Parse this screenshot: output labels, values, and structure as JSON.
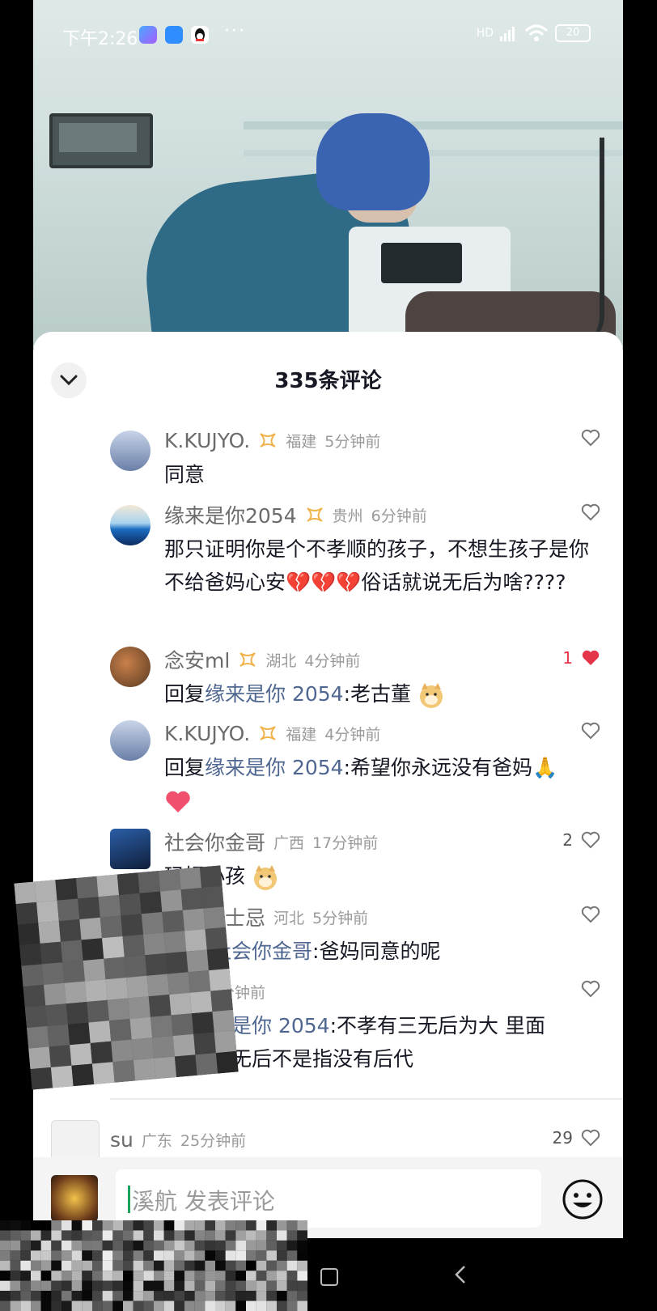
{
  "status_bar": {
    "time": "下午2:26",
    "dots": "···",
    "network": "HD",
    "battery": "20"
  },
  "sheet": {
    "title": "335条评论"
  },
  "comments": [
    {
      "user": "K.KUJYO.",
      "location": "福建",
      "time": "5分钟前",
      "text": "同意",
      "likes": ""
    },
    {
      "user": "缘来是你2054",
      "location": "贵州",
      "time": "6分钟前",
      "text": "那只证明你是个不孝顺的孩子，不想生孩子是你不给爸妈心安💔💔💔俗话就说无后为啥????",
      "likes": ""
    },
    {
      "user": "念安ml",
      "location": "湖北",
      "time": "4分钟前",
      "reply_prefix": "回复",
      "reply_to": "缘来是你 2054",
      "text": ":老古董",
      "likes": "1"
    },
    {
      "user": "K.KUJYO.",
      "location": "福建",
      "time": "4分钟前",
      "reply_prefix": "回复",
      "reply_to": "缘来是你 2054",
      "text": ":希望你永远没有爸妈🙏",
      "likes": ""
    },
    {
      "user": "社会你金哥",
      "location": "广西",
      "time": "17分钟前",
      "text": "玛娌小孩",
      "likes": "2"
    },
    {
      "user": "威士忌",
      "location": "河北",
      "time": "5分钟前",
      "reply_to": "社会你金哥",
      "text": ":爸妈同意的呢",
      "likes": ""
    },
    {
      "user": "",
      "location": "",
      "time": "分钟前",
      "reply_to": "来是你 2054",
      "text": ":不孝有三无后为大 里面",
      "text2": "的无后不是指没有后代",
      "likes": ""
    },
    {
      "user": "su",
      "location": "广东",
      "time": "25分钟前",
      "likes": "29"
    }
  ],
  "input": {
    "placeholder": "溪航 发表评论"
  },
  "colors": {
    "accent_red": "#e5354a",
    "reply_blue": "#4f6790",
    "caret_green": "#1aa35b"
  }
}
